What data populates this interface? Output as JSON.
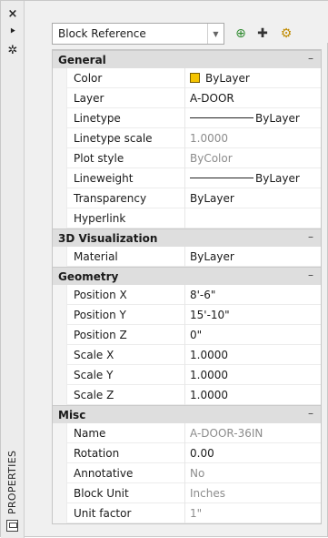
{
  "strip": {
    "title": "PROPERTIES",
    "close": "×",
    "pin": "⯈",
    "settings": "✲"
  },
  "selector": {
    "value": "Block Reference"
  },
  "toolbar": {
    "icon1": "⊕",
    "icon2": "✚",
    "icon3": "⚙"
  },
  "grid": {
    "general": {
      "title": "General",
      "toggle": "–",
      "rows": [
        {
          "label": "Color",
          "value": "ByLayer"
        },
        {
          "label": "Layer",
          "value": "A-DOOR"
        },
        {
          "label": "Linetype",
          "value": "ByLayer"
        },
        {
          "label": "Linetype scale",
          "value": "1.0000"
        },
        {
          "label": "Plot style",
          "value": "ByColor"
        },
        {
          "label": "Lineweight",
          "value": "ByLayer"
        },
        {
          "label": "Transparency",
          "value": "ByLayer"
        },
        {
          "label": "Hyperlink",
          "value": ""
        }
      ]
    },
    "viz3d": {
      "title": "3D Visualization",
      "toggle": "–",
      "rows": [
        {
          "label": "Material",
          "value": "ByLayer"
        }
      ]
    },
    "geometry": {
      "title": "Geometry",
      "toggle": "–",
      "rows": [
        {
          "label": "Position X",
          "value": "8'-6\""
        },
        {
          "label": "Position Y",
          "value": "15'-10\""
        },
        {
          "label": "Position Z",
          "value": "0\""
        },
        {
          "label": "Scale X",
          "value": "1.0000"
        },
        {
          "label": "Scale Y",
          "value": "1.0000"
        },
        {
          "label": "Scale Z",
          "value": "1.0000"
        }
      ]
    },
    "misc": {
      "title": "Misc",
      "toggle": "–",
      "rows": [
        {
          "label": "Name",
          "value": "A-DOOR-36IN"
        },
        {
          "label": "Rotation",
          "value": "0.00"
        },
        {
          "label": "Annotative",
          "value": "No"
        },
        {
          "label": "Block Unit",
          "value": "Inches"
        },
        {
          "label": "Unit factor",
          "value": "1\""
        }
      ]
    }
  },
  "colors": {
    "swatch": "#f5c400",
    "category_bg": "#dedede",
    "dim_text": "#8c8c8c"
  }
}
